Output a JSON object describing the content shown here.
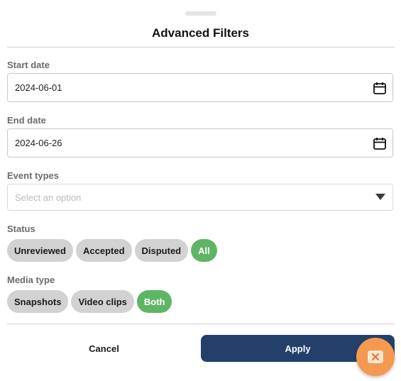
{
  "header": {
    "title": "Advanced Filters"
  },
  "start_date": {
    "label": "Start date",
    "value": "2024-06-01",
    "icon": "calendar-icon"
  },
  "end_date": {
    "label": "End date",
    "value": "2024-06-26",
    "icon": "calendar-icon"
  },
  "event_types": {
    "label": "Event types",
    "placeholder": "Select an option",
    "icon": "chevron-down-icon"
  },
  "status": {
    "label": "Status",
    "options": [
      "Unreviewed",
      "Accepted",
      "Disputed",
      "All"
    ],
    "selected": "All"
  },
  "media_type": {
    "label": "Media type",
    "options": [
      "Snapshots",
      "Video clips",
      "Both"
    ],
    "selected": "Both"
  },
  "actions": {
    "cancel_label": "Cancel",
    "apply_label": "Apply"
  },
  "fab": {
    "icon": "close-box-icon"
  },
  "colors": {
    "accent": "#5fb565",
    "primary": "#23406b",
    "fab": "#f49a50",
    "chip_inactive": "#d2d2d2"
  }
}
